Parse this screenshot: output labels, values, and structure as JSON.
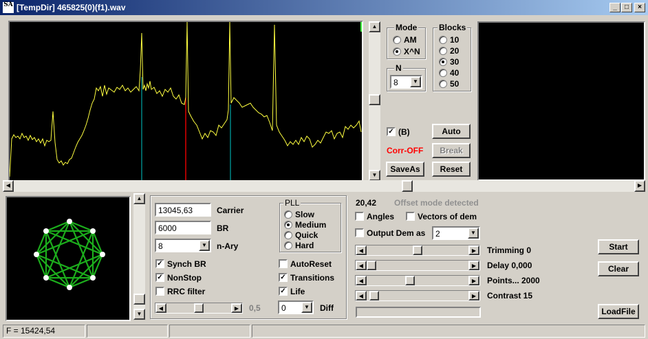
{
  "window": {
    "app_icon_text": "SA",
    "title": "[TempDir] 465825(0)(f1).wav",
    "minimize": "_",
    "maximize": "□",
    "close": "×"
  },
  "spectrum": {
    "marker_colors": {
      "cyan": "#00c8c8",
      "red": "#e00000",
      "green": "#40ff40",
      "trace": "#ffff40"
    }
  },
  "mode_group": {
    "title": "Mode",
    "options": [
      "AM",
      "X^N"
    ],
    "selected": "X^N"
  },
  "n_group": {
    "title": "N",
    "value": "8"
  },
  "blocks_group": {
    "title": "Blocks",
    "options": [
      "10",
      "20",
      "30",
      "40",
      "50"
    ],
    "selected": "30"
  },
  "right_controls": {
    "b_checkbox_label": "(B)",
    "b_checked": true,
    "corr_label": "Corr-OFF",
    "corr_color": "#ff0000",
    "auto_button": "Auto",
    "break_button": "Break",
    "saveas_button": "SaveAs",
    "reset_button": "Reset"
  },
  "demod": {
    "carrier_value": "13045,63",
    "carrier_label": "Carrier",
    "br_value": "6000",
    "br_label": "BR",
    "nary_value": "8",
    "nary_label": "n-Ary",
    "synch_br_label": "Synch BR",
    "synch_br_checked": true,
    "nonstop_label": "NonStop",
    "nonstop_checked": true,
    "rrc_label": "RRC filter",
    "rrc_checked": false,
    "rrc_slider_value": "0,5",
    "pll_title": "PLL",
    "pll_options": [
      "Slow",
      "Medium",
      "Quick",
      "Hard"
    ],
    "pll_selected": "Medium",
    "autoreset_label": "AutoReset",
    "autoreset_checked": false,
    "transitions_label": "Transitions",
    "transitions_checked": true,
    "life_label": "Life",
    "life_checked": true,
    "diff_value": "0",
    "diff_label": "Diff"
  },
  "analysis": {
    "value_readout": "20,42",
    "offset_status": "Offset mode detected",
    "angles_label": "Angles",
    "angles_checked": false,
    "vectors_label": "Vectors of dem",
    "vectors_checked": false,
    "output_dem_label": "Output Dem as",
    "output_dem_checked": false,
    "output_dem_value": "2",
    "trimming_label": "Trimming 0",
    "trimming_level": 0.5,
    "delay_label": "Delay  0,000",
    "delay_level": 0.0,
    "points_label": "Points... 2000",
    "points_level": 0.42,
    "contrast_label": "Contrast 15",
    "contrast_level": 0.03
  },
  "buttons": {
    "start": "Start",
    "clear": "Clear",
    "loadfile": "LoadFile"
  },
  "status_bar": {
    "frequency": "F = 15424,54",
    "cell2": "",
    "cell3": "",
    "cell4": ""
  }
}
